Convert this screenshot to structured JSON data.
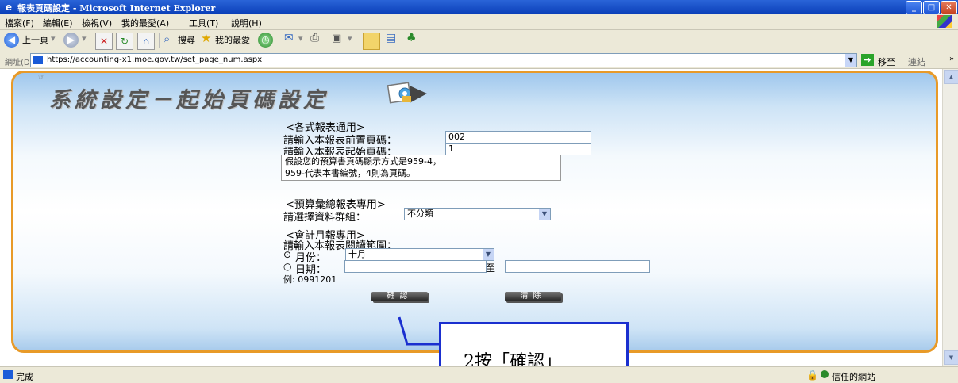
{
  "window": {
    "title": "報表頁碼設定 - Microsoft Internet Explorer"
  },
  "menu": [
    "檔案(F)",
    "編輯(E)",
    "檢視(V)",
    "我的最愛(A)",
    "工具(T)",
    "說明(H)"
  ],
  "toolbar": {
    "back_label": "上一頁",
    "search_label": "搜尋",
    "favorites_label": "我的最愛"
  },
  "address": {
    "label": "網址(D)",
    "url": "https://accounting-x1.moe.gov.tw/set_page_num.aspx",
    "go_label": "移至",
    "links_label": "連結"
  },
  "page": {
    "banner_title": "系統設定－起始頁碼設定",
    "section_general": "<各式報表通用>",
    "prefix_label": "請輸入本報表前置頁碼：",
    "prefix_value": "002",
    "start_label": "請輸入本報表起始頁碼：",
    "start_value": "1",
    "note_line1": "假設您的預算書頁碼顯示方式是959-4，",
    "note_line2": "959-代表本書編號，4則為頁碼。",
    "section_budget": "<預算彙總報表專用>",
    "group_label": "請選擇資料群組：",
    "group_value": "不分類",
    "section_monthly": "<會計月報專用>",
    "range_label": "請輸入本報表閱讀範圍：",
    "month_label": "月份：",
    "month_value": "十月",
    "date_label": "日期：",
    "date_to": "至",
    "example": "例: 0991201",
    "confirm_label": "確認",
    "clear_label": "清除"
  },
  "status": {
    "left": "完成",
    "right": "信任的網站"
  },
  "callout": {
    "text": "2按「確認」"
  },
  "colors": {
    "title_bar": "#0a3fb8",
    "frame_border": "#e89a28",
    "callout_border": "#1a2fcf"
  }
}
